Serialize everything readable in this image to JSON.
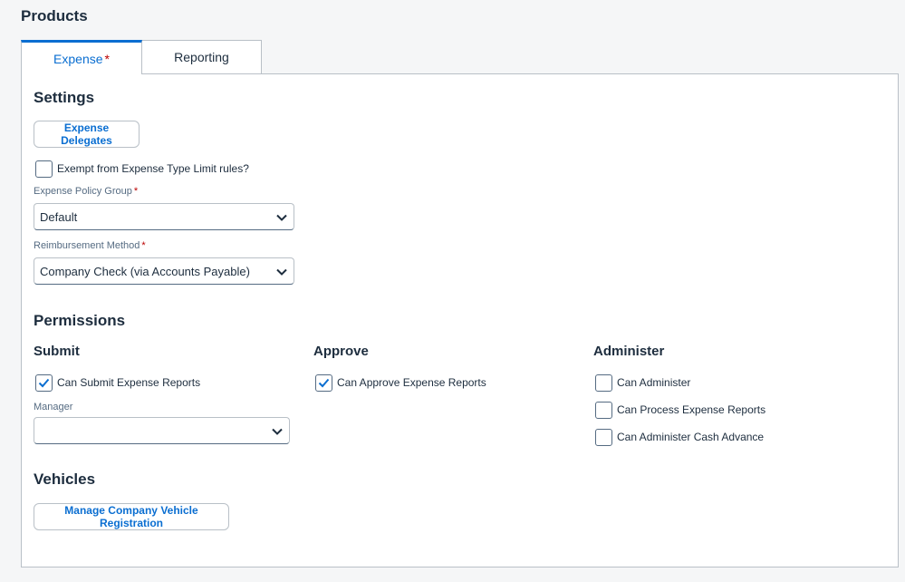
{
  "page": {
    "title": "Products"
  },
  "tabs": [
    {
      "label": "Expense",
      "required_mark": "*",
      "selected": true
    },
    {
      "label": "Reporting",
      "selected": false
    }
  ],
  "settings": {
    "title": "Settings",
    "delegates_button": "Expense Delegates",
    "exempt_checkbox": {
      "label": "Exempt from Expense Type Limit rules?",
      "checked": false
    },
    "policy_group": {
      "label": "Expense Policy Group",
      "required_mark": "*",
      "value": "Default"
    },
    "reimbursement": {
      "label": "Reimbursement Method",
      "required_mark": "*",
      "value": "Company Check (via Accounts Payable)"
    }
  },
  "permissions": {
    "title": "Permissions",
    "submit": {
      "title": "Submit",
      "can_submit": {
        "label": "Can Submit Expense Reports",
        "checked": true
      },
      "manager": {
        "label": "Manager",
        "value": ""
      }
    },
    "approve": {
      "title": "Approve",
      "can_approve": {
        "label": "Can Approve Expense Reports",
        "checked": true
      }
    },
    "administer": {
      "title": "Administer",
      "items": [
        {
          "label": "Can Administer",
          "checked": false
        },
        {
          "label": "Can Process Expense Reports",
          "checked": false
        },
        {
          "label": "Can Administer Cash Advance",
          "checked": false
        }
      ]
    }
  },
  "vehicles": {
    "title": "Vehicles",
    "manage_button": "Manage Company Vehicle Registration"
  },
  "icons": {
    "checkmark": "checkmark-icon",
    "dropdown": "chevron-down-icon"
  },
  "colors": {
    "accent": "#0a6ed1",
    "required": "#bb0000",
    "text": "#1d2d3e",
    "border": "#b9c0c7"
  }
}
